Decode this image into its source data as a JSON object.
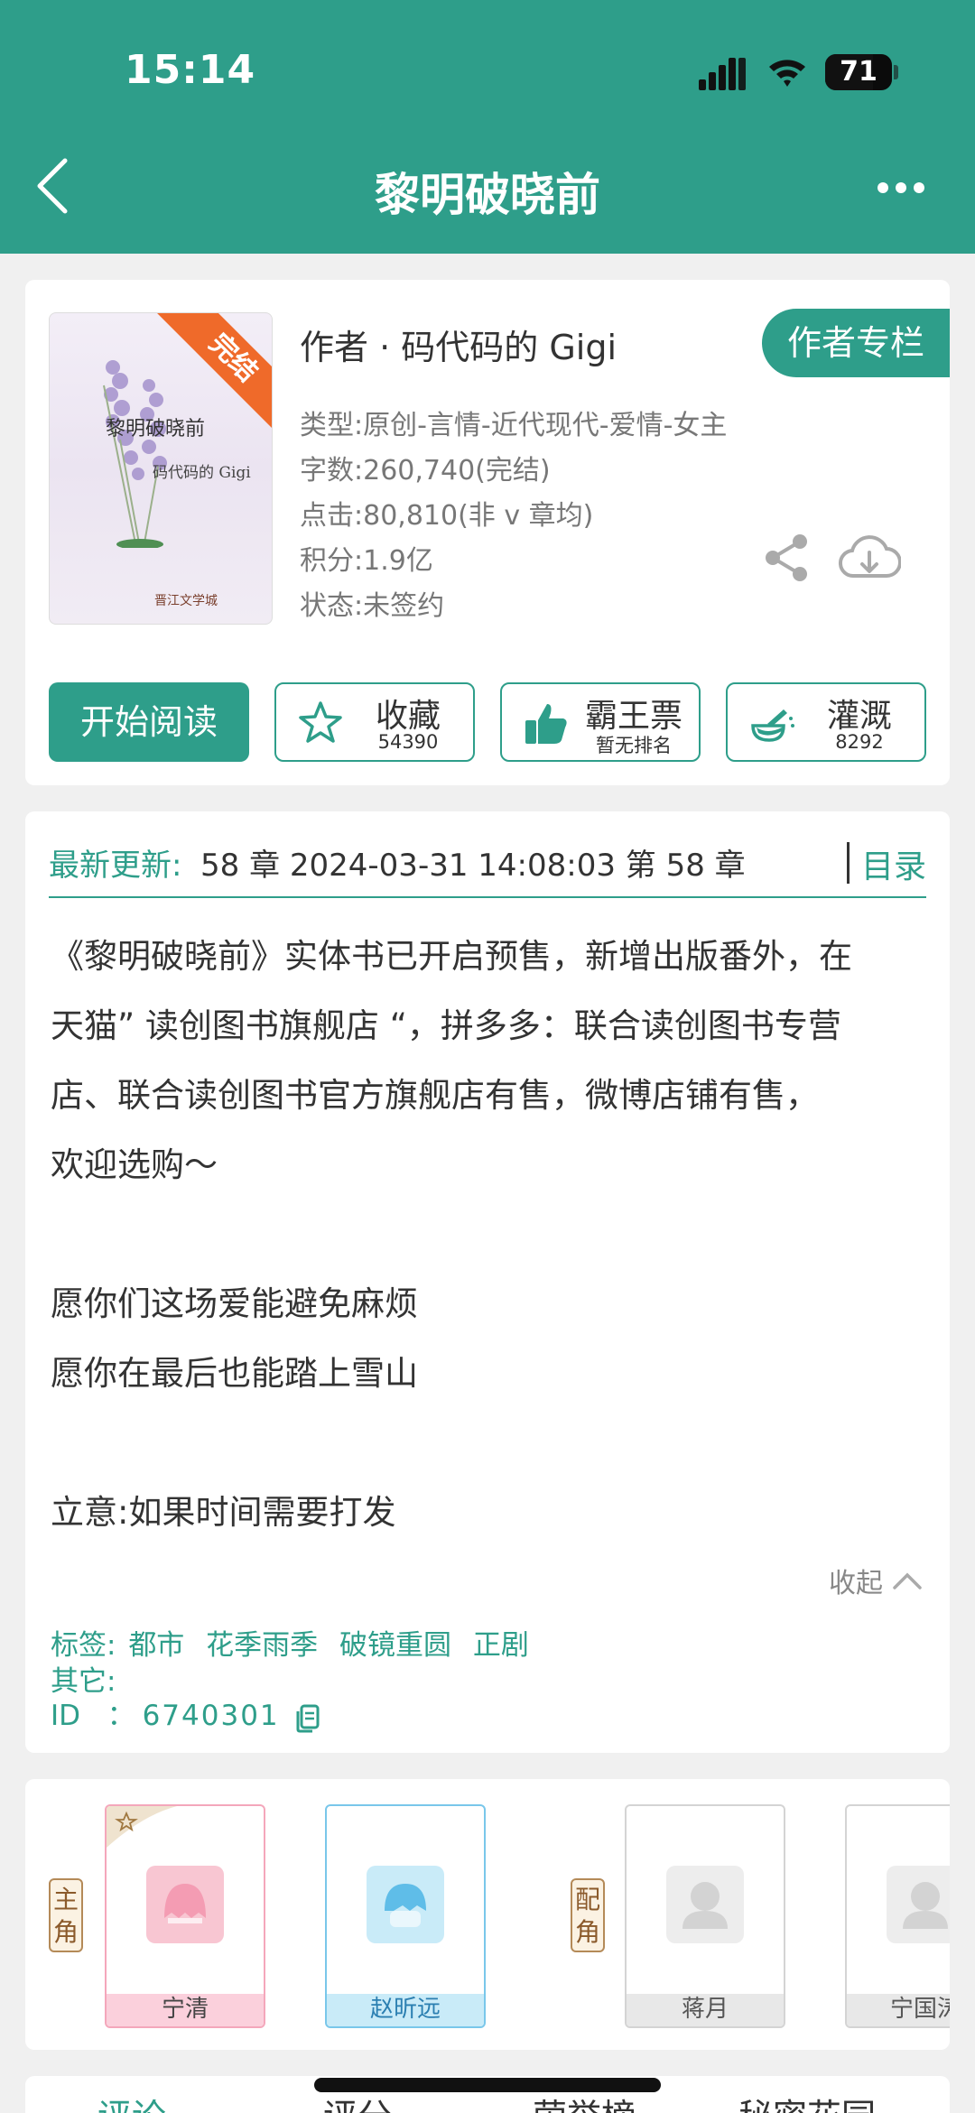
{
  "status_bar": {
    "time": "15:14",
    "battery": "71",
    "battery_level": 0.71
  },
  "header": {
    "title": "黎明破晓前"
  },
  "book": {
    "cover": {
      "title": "黎明破晓前",
      "author": "码代码的 Gigi",
      "badge": "完结",
      "publisher_mark": "晋江文学城"
    },
    "author_line": "作者 · 码代码的 Gigi",
    "author_column_label": "作者专栏",
    "type": "类型:原创-言情-近代现代-爱情-女主",
    "words": "字数:260,740(完结)",
    "clicks": "点击:80,810(非 v 章均)",
    "points": "积分:1.9亿",
    "status": "状态:未签约"
  },
  "actions": {
    "read_label": "开始阅读",
    "favorite": {
      "label": "收藏",
      "count": "54390"
    },
    "bawang": {
      "label": "霸王票",
      "sub": "暂无排名"
    },
    "nutrient": {
      "label": "灌溉",
      "count": "8292"
    }
  },
  "update": {
    "label": "最新更新:",
    "text": "58 章 2024-03-31 14:08:03   第 58 章",
    "toc_label": "目录"
  },
  "intro": {
    "lines": [
      "《黎明破晓前》实体书已开启预售，新增出版番外，在",
      "天猫” 读创图书旗舰店 “，拼多多：联合读创图书专营",
      "店、联合读创图书官方旗舰店有售，微博店铺有售，",
      "欢迎选购～",
      "",
      "愿你们这场爱能避免麻烦",
      "愿你在最后也能踏上雪山",
      "",
      "立意:如果时间需要打发"
    ],
    "collapse_label": "收起"
  },
  "tags": {
    "label": "标签:",
    "items": [
      "都市",
      "花季雨季",
      "破镜重圆",
      "正剧"
    ],
    "other_label": "其它:",
    "id_label": "ID   ：",
    "id_value": "6740301"
  },
  "characters": {
    "main_label": "主角",
    "support_label": "配角",
    "list": [
      {
        "name": "宁清"
      },
      {
        "name": "赵昕远"
      },
      {
        "name": "蒋月"
      },
      {
        "name": "宁国涛"
      }
    ]
  },
  "bottom_tabs": [
    "评论",
    "评分",
    "荣誉榜",
    "秘密花园"
  ],
  "colors": {
    "accent": "#2e9e8a",
    "ribbon": "#ef6a2a",
    "pink": "#f4a7bb",
    "blue": "#79c7ea"
  }
}
